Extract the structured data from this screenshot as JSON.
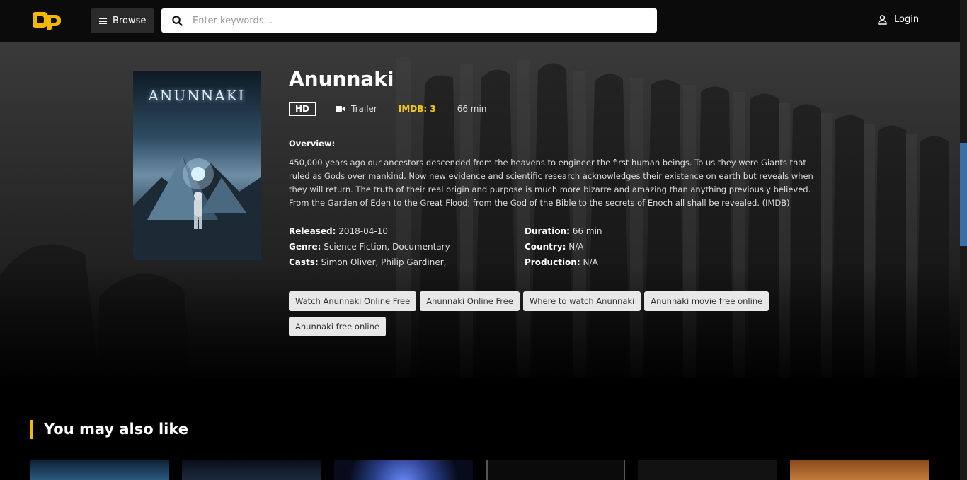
{
  "header": {
    "browse_label": "Browse",
    "search_placeholder": "Enter keywords...",
    "login_label": "Login",
    "brand_color": "#f5b800"
  },
  "poster": {
    "title_text": "ANUNNAKI"
  },
  "movie": {
    "title": "Anunnaki",
    "quality": "HD",
    "trailer_label": "Trailer",
    "imdb": "IMDB: 3",
    "runtime": "66 min",
    "overview_label": "Overview:",
    "overview": "450,000 years ago our ancestors descended from the heavens to engineer the first human beings. To us they were Giants that ruled as Gods over mankind. Now new evidence and scientific research acknowledges their existence on earth but reveals when they will return. The truth of their real origin and purpose is much more bizarre and amazing than anything previously believed. From the Garden of Eden to the Great Flood; from the God of the Bible to the secrets of Enoch all shall be revealed. (IMDB)",
    "released_label": "Released:",
    "released": "2018-04-10",
    "genre_label": "Genre:",
    "genre": "Science Fiction, Documentary",
    "casts_label": "Casts:",
    "casts": "Simon Oliver, Philip Gardiner,",
    "duration_label": "Duration:",
    "duration": "66 min",
    "country_label": "Country:",
    "country": "N/A",
    "production_label": "Production:",
    "production": "N/A"
  },
  "tags": [
    "Watch Anunnaki Online Free",
    "Anunnaki Online Free",
    "Where to watch Anunnaki",
    "Anunnaki movie free online",
    "Anunnaki free online"
  ],
  "section": {
    "also_like_title": "You may also like"
  },
  "colors": {
    "imdb": "#f5c518",
    "accent": "#f5b800",
    "scrollbar": "#3b6ea5"
  }
}
